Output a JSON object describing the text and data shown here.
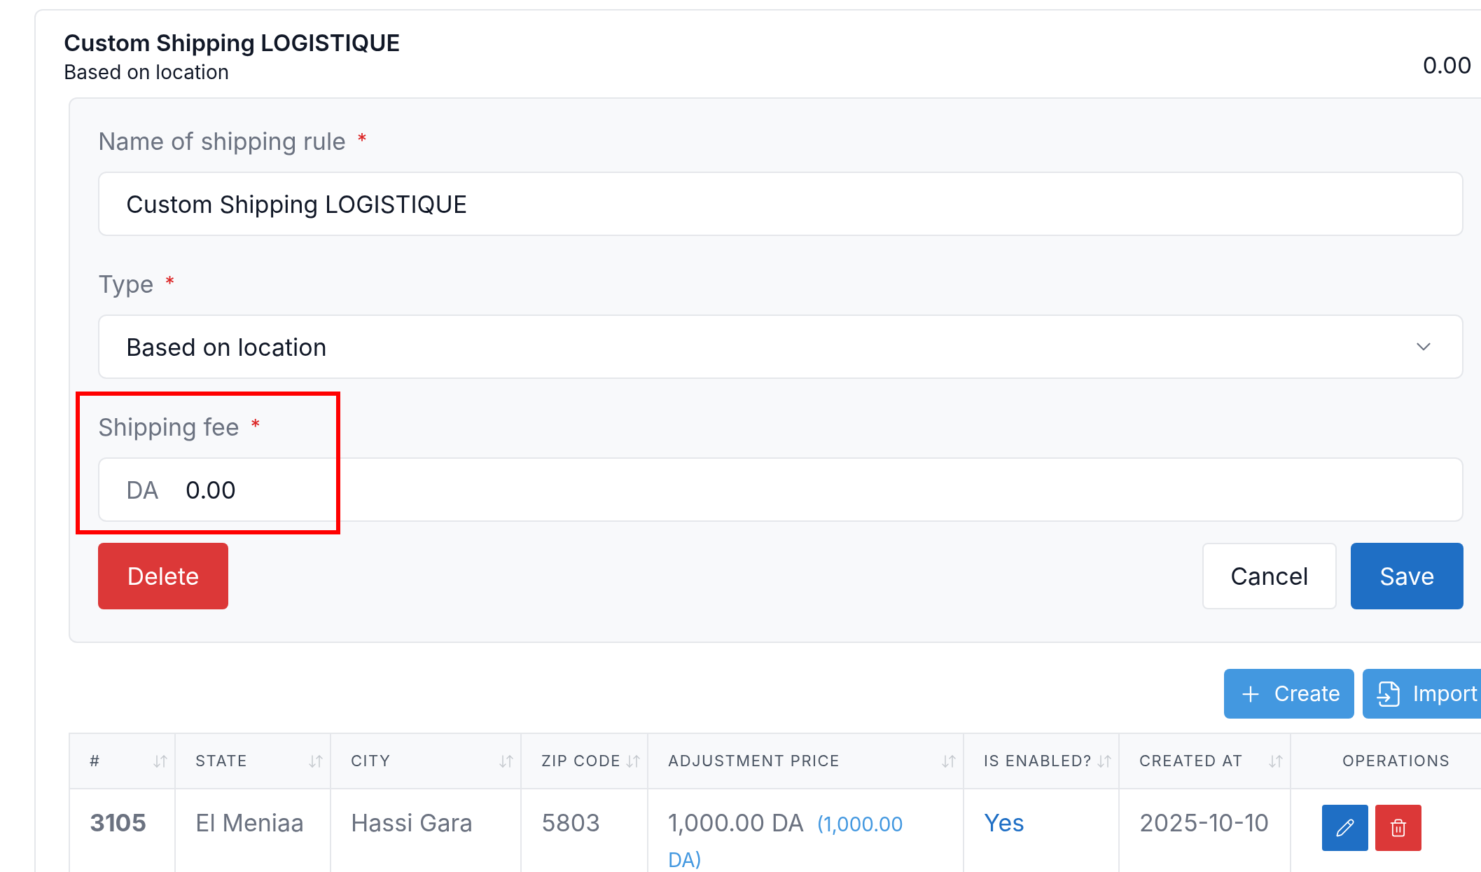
{
  "card": {
    "title": "Custom Shipping LOGISTIQUE",
    "subtitle": "Based on location",
    "amount": "0.00"
  },
  "form": {
    "fields": [
      {
        "kind": "text",
        "label": "Name of shipping rule",
        "required": true,
        "required_mark": "*",
        "value": "Custom Shipping LOGISTIQUE"
      },
      {
        "kind": "select",
        "label": "Type",
        "required": true,
        "required_mark": "*",
        "value": "Based on location"
      },
      {
        "kind": "money",
        "label": "Shipping fee",
        "required": true,
        "required_mark": "*",
        "prefix": "DA",
        "value": "0.00",
        "highlighted": true
      }
    ],
    "delete_button": "Delete",
    "cancel_button": "Cancel",
    "save_button": "Save"
  },
  "toolbar": {
    "create_button": "Create",
    "import_button": "Import"
  },
  "table": {
    "columns": [
      {
        "label": "#",
        "sortable": true
      },
      {
        "label": "STATE",
        "sortable": true
      },
      {
        "label": "CITY",
        "sortable": true
      },
      {
        "label": "ZIP CODE",
        "sortable": true
      },
      {
        "label": "ADJUSTMENT PRICE",
        "sortable": true
      },
      {
        "label": "IS ENABLED?",
        "sortable": true
      },
      {
        "label": "CREATED AT",
        "sortable": true
      },
      {
        "label": "OPERATIONS",
        "sortable": false
      }
    ],
    "rows": [
      {
        "id": "3105",
        "state": "El Meniaa",
        "city": "Hassi Gara",
        "zip": "5803",
        "price": "1,000.00 DA",
        "price_detail": "(1,000.00 DA)",
        "enabled": "Yes",
        "created_at": "2025-10-10"
      }
    ]
  }
}
